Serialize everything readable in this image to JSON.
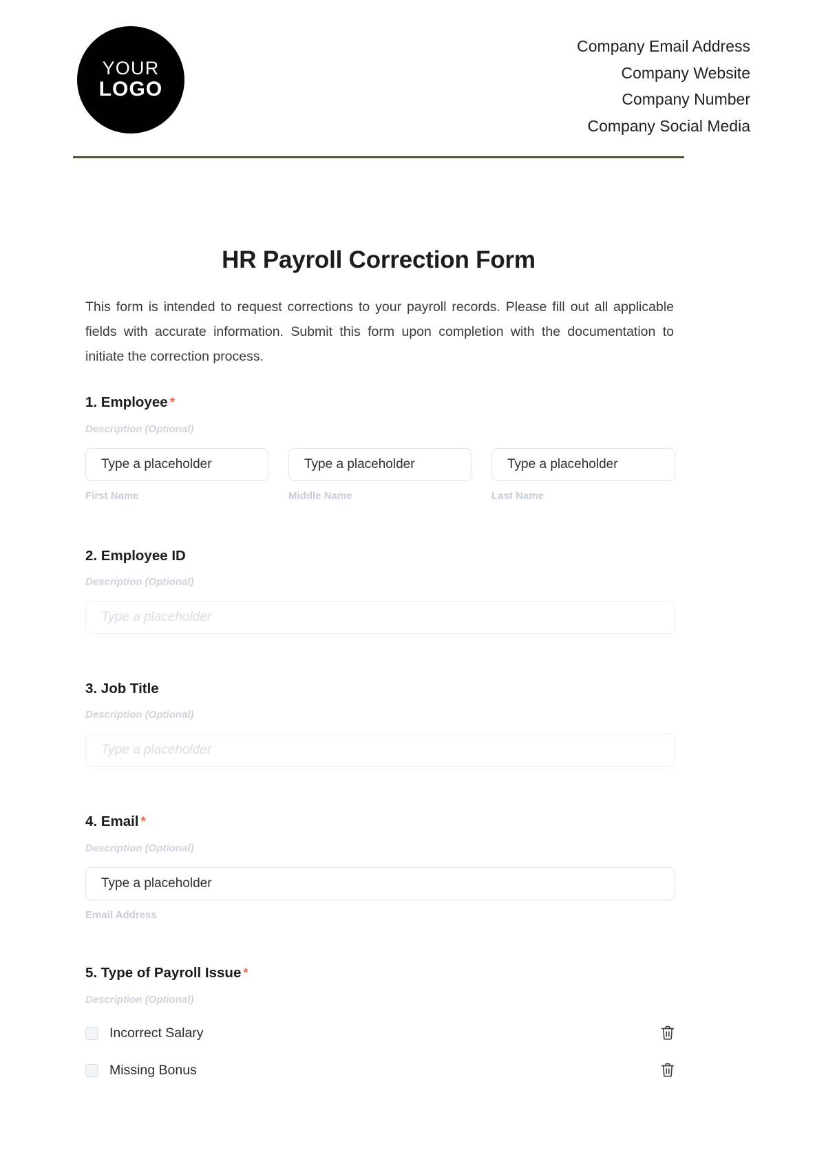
{
  "header": {
    "logo": {
      "line1": "YOUR",
      "line2": "LOGO"
    },
    "company": [
      "Company Email Address",
      "Company Website",
      "Company Number",
      "Company Social Media"
    ],
    "rule_color": "#56512f"
  },
  "document": {
    "title": "HR Payroll Correction Form",
    "intro": "This form is intended to request corrections to your payroll records. Please fill out all applicable fields with accurate information. Submit this form upon completion with the documentation to initiate the correction process."
  },
  "common": {
    "description_placeholder": "Description (Optional)",
    "field_placeholder": "Type a placeholder",
    "required_marker": "*",
    "required_color": "#f26c4f"
  },
  "questions": [
    {
      "number": "1.",
      "title": "1. Employee",
      "required": true,
      "description": "Description (Optional)",
      "type": "name",
      "fields": [
        {
          "placeholder": "Type a placeholder",
          "sub_label": "First Name"
        },
        {
          "placeholder": "Type a placeholder",
          "sub_label": "Middle Name"
        },
        {
          "placeholder": "Type a placeholder",
          "sub_label": "Last Name"
        }
      ]
    },
    {
      "number": "2.",
      "title": "2. Employee ID",
      "required": false,
      "description": "Description (Optional)",
      "type": "text",
      "placeholder": "Type a placeholder"
    },
    {
      "number": "3.",
      "title": "3. Job Title",
      "required": false,
      "description": "Description (Optional)",
      "type": "text",
      "placeholder": "Type a placeholder"
    },
    {
      "number": "4.",
      "title": "4. Email",
      "required": true,
      "description": "Description (Optional)",
      "type": "email",
      "placeholder": "Type a placeholder",
      "sub_label": "Email Address"
    },
    {
      "number": "5.",
      "title": "5. Type of Payroll Issue",
      "required": true,
      "description": "Description (Optional)",
      "type": "checkbox",
      "options": [
        {
          "label": "Incorrect Salary",
          "checked": false,
          "delete_icon": "trash-icon"
        },
        {
          "label": "Missing Bonus",
          "checked": false,
          "delete_icon": "trash-icon"
        }
      ]
    }
  ]
}
